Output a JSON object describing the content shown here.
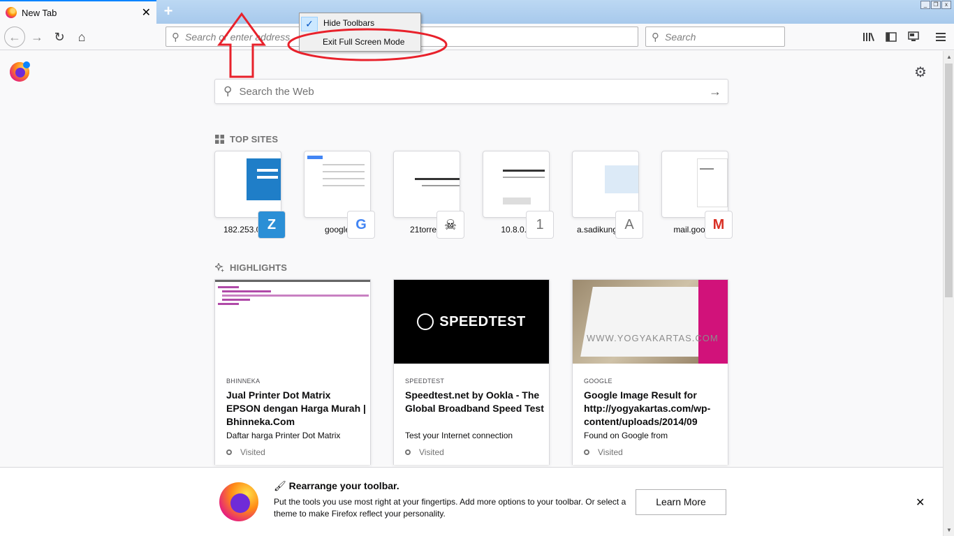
{
  "tab": {
    "title": "New Tab",
    "close": "✕",
    "new_tab": "+"
  },
  "navbar": {
    "back": "←",
    "forward": "→",
    "reload": "↻",
    "home": "⌂",
    "url_placeholder": "Search or enter address",
    "search_placeholder": "Search",
    "library": "|||\\",
    "sidebar": "▯",
    "sync": "▭",
    "menu": "≡"
  },
  "context_menu": {
    "check": "✓",
    "hide_toolbars": "Hide Toolbars",
    "exit_full_screen": "Exit Full Screen Mode"
  },
  "newtab": {
    "search_placeholder": "Search the Web",
    "go": "→",
    "settings": "⚙",
    "top_sites_title": "TOP SITES",
    "highlights_title": "HIGHLIGHTS",
    "top_sites": [
      {
        "label": "182.253.0.30",
        "badge": "Z",
        "badge_color": "#2b8fd6"
      },
      {
        "label": "google",
        "badge": "G",
        "badge_color": "#4285f4"
      },
      {
        "label": "21torrent",
        "badge": "☠",
        "badge_color": "#000000"
      },
      {
        "label": "10.8.0.1",
        "badge": "1",
        "badge_color": "#737373"
      },
      {
        "label": "a.sadikungroup",
        "badge": "A",
        "badge_color": "#737373"
      },
      {
        "label": "mail.google",
        "badge": "M",
        "badge_color": "#d93025"
      }
    ],
    "highlights": [
      {
        "source": "BHINNEKA",
        "title": "Jual Printer Dot Matrix EPSON dengan Harga Murah | Bhinneka.Com",
        "desc": "Daftar harga Printer Dot Matrix",
        "visited": "Visited"
      },
      {
        "source": "SPEEDTEST",
        "title": "Speedtest.net by Ookla - The Global Broadband Speed Test",
        "desc": "Test your Internet connection",
        "visited": "Visited",
        "image_text": "SPEEDTEST"
      },
      {
        "source": "GOOGLE",
        "title": "Google Image Result for http://yogyakartas.com/wp-content/uploads/2014/09",
        "desc": "Found on Google from",
        "visited": "Visited",
        "image_text": "WWW.YOGYAKARTAS.COM"
      }
    ]
  },
  "snippet": {
    "title": "Rearrange your toolbar.",
    "text": "Put the tools you use most right at your fingertips. Add more options to your toolbar. Or select a theme to make Firefox reflect your personality.",
    "button": "Learn More",
    "close": "✕"
  },
  "colors": {
    "accent": "#0a84ff",
    "annotation_red": "#e8212b",
    "tabstrip": "#a9cdf0"
  }
}
